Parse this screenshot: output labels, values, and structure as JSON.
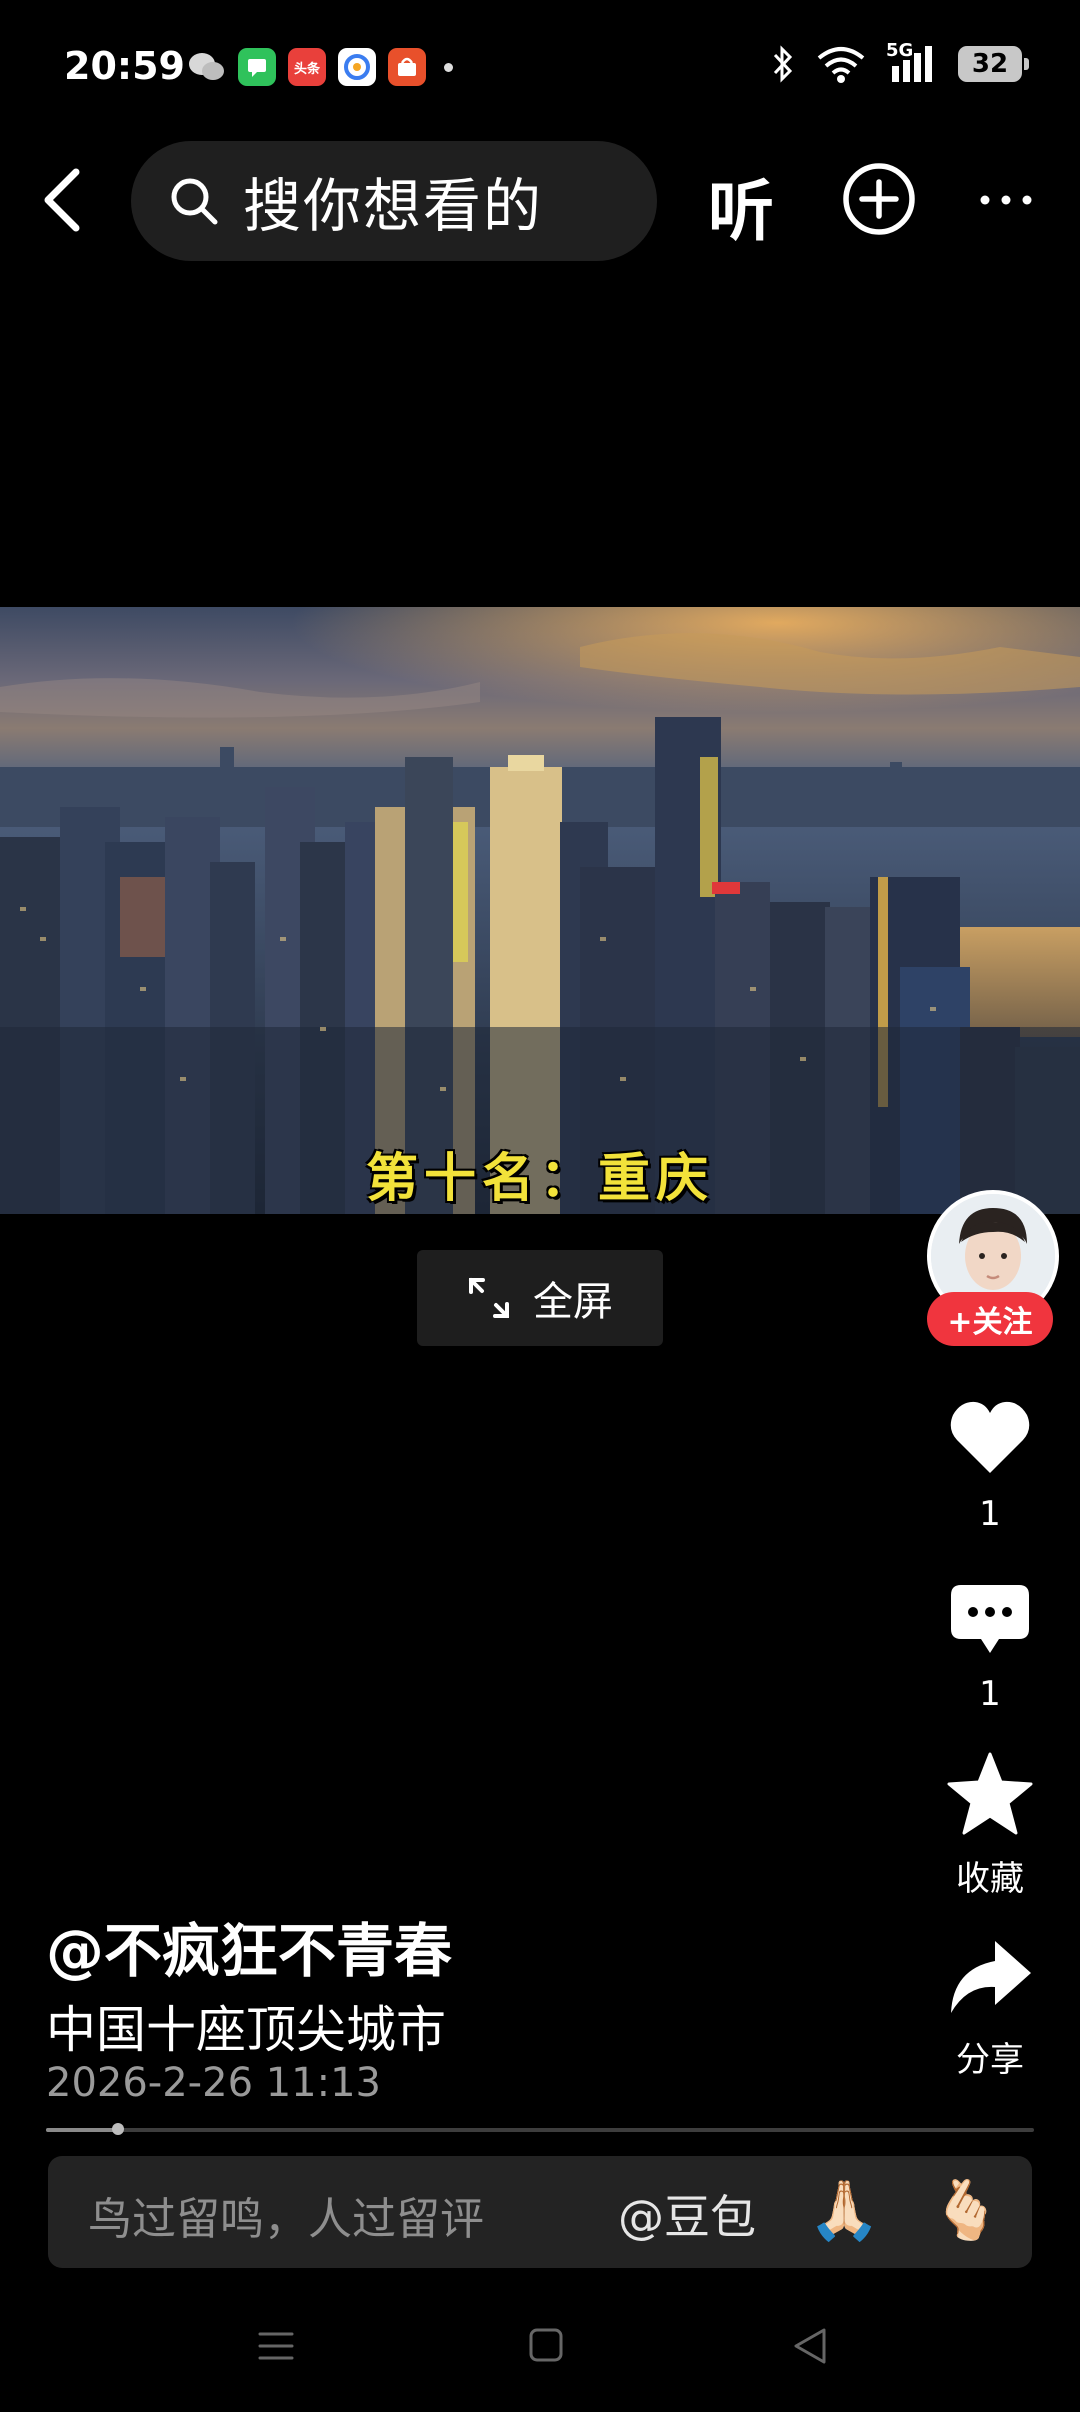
{
  "status_bar": {
    "time": "20:59",
    "network": "5G",
    "battery": "32",
    "notifications": [
      {
        "name": "wechat-icon",
        "color": "#1a1a1a"
      },
      {
        "name": "messages-icon",
        "color": "#2fc25b"
      },
      {
        "name": "toutiao-icon",
        "color": "#e9403b",
        "text": "头条"
      },
      {
        "name": "browser-icon",
        "color": "#ffffff"
      },
      {
        "name": "shop-icon",
        "color": "#e8502b"
      }
    ]
  },
  "top_bar": {
    "search_placeholder": "搜你想看的",
    "listen_label": "听"
  },
  "video": {
    "subtitle": "第十名：重庆"
  },
  "fullscreen_label": "全屏",
  "rail": {
    "follow_label": "+关注",
    "like_count": "1",
    "comment_count": "1",
    "favorite_label": "收藏",
    "share_label": "分享"
  },
  "post": {
    "author": "@不疯狂不青春",
    "caption": "中国十座顶尖城市",
    "date": "2026-2-26 11:13",
    "progress": 0.073
  },
  "comment_bar": {
    "placeholder": "鸟过留鸣，人过留评",
    "mention": "@豆包",
    "emoji_1": "🙏🏻",
    "emoji_2": "🫰🏻"
  },
  "colors": {
    "accent_follow": "#f0353e",
    "subtitle_yellow": "#f2e23a",
    "background": "#000000"
  }
}
